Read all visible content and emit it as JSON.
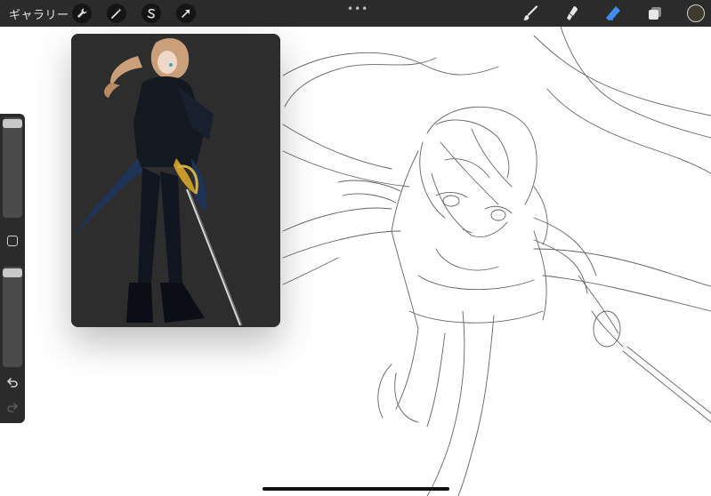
{
  "topbar": {
    "gallery_label": "ギャラリー",
    "more_label": "•••"
  },
  "left_tools": [
    "wrench-icon",
    "magic-wand-icon",
    "selection-icon",
    "transform-arrow-icon"
  ],
  "right_tools": [
    "brush-icon",
    "smudge-icon",
    "eraser-icon",
    "layers-icon"
  ],
  "active_tool": "eraser",
  "colors": {
    "toolbar_bg": "#2b2b2b",
    "active_tool": "#3f8cf0",
    "current_color": "#3d3a2e"
  },
  "sidebar": {
    "brush_size_level": 0.97,
    "opacity_level": 0.97
  }
}
